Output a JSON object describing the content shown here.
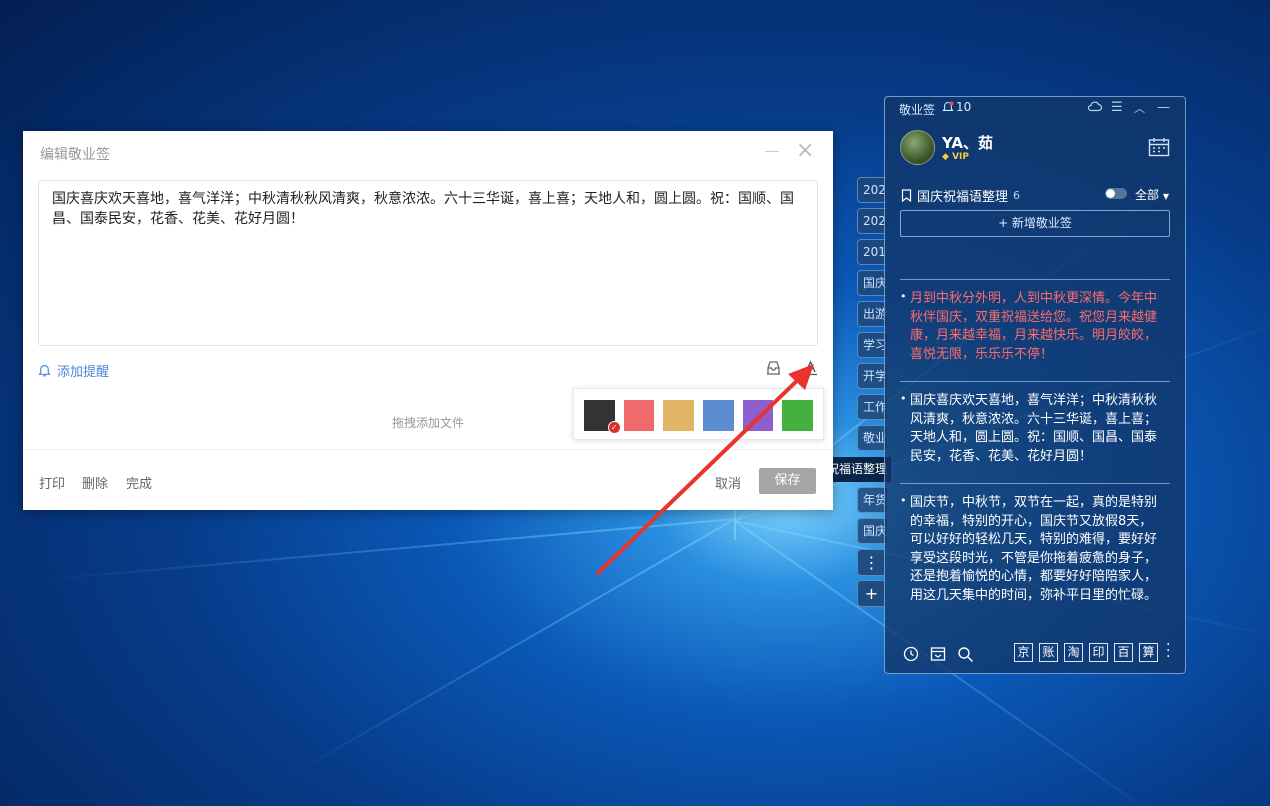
{
  "editor": {
    "title": "编辑敬业签",
    "content": "国庆喜庆欢天喜地，喜气洋洋；中秋清秋秋风清爽，秋意浓浓。六十三华诞，喜上喜；天地人和，圆上圆。祝：国顺、国昌、国泰民安，花香、花美、花好月圆！",
    "add_reminder": "添加提醒",
    "drag_hint": "拖拽添加文件",
    "colors": [
      "#333333",
      "#ef6a6a",
      "#e2b466",
      "#5b8bd0",
      "#8e5ecf",
      "#44b03e"
    ],
    "print": "打印",
    "delete": "删除",
    "done": "完成",
    "cancel": "取消",
    "save": "保存"
  },
  "tabs": [
    "202",
    "202",
    "201",
    "国庆",
    "出游",
    "学习",
    "开学",
    "工作",
    "敬业"
  ],
  "active_tab": "国庆祝福语整理",
  "tabs_after": [
    "年货",
    "国庆"
  ],
  "widget": {
    "brand": "敬业签",
    "notif_count": "10",
    "username": "YA、茹",
    "vip": "VIP",
    "notebook": "国庆祝福语整理",
    "notebook_count": "6",
    "filter": "全部",
    "new_note": "+ 新增敬业签",
    "notes": [
      {
        "text": "月到中秋分外明，人到中秋更深情。今年中秋伴国庆，双重祝福送给您。祝您月来越健康，月来越幸福，月来越快乐。明月皎皎，喜悦无限，乐乐乐不停！",
        "color": "#ff6b6b"
      },
      {
        "text": "国庆喜庆欢天喜地，喜气洋洋；中秋清秋秋风清爽，秋意浓浓。六十三华诞，喜上喜；天地人和，圆上圆。祝：国顺、国昌、国泰民安，花香、花美、花好月圆！",
        "color": "#ffffff"
      },
      {
        "text": "国庆节，中秋节，双节在一起，真的是特别的幸福，特别的开心，国庆节又放假8天，可以好好的轻松几天，特别的难得，要好好享受这段时光，不管是你拖着疲惫的身子，还是抱着愉悦的心情，都要好好陪陪家人，用这几天集中的时间，弥补平日里的忙碌。",
        "color": "#ffffff"
      }
    ],
    "shortcuts": [
      "京",
      "账",
      "淘",
      "印",
      "百",
      "算"
    ]
  }
}
